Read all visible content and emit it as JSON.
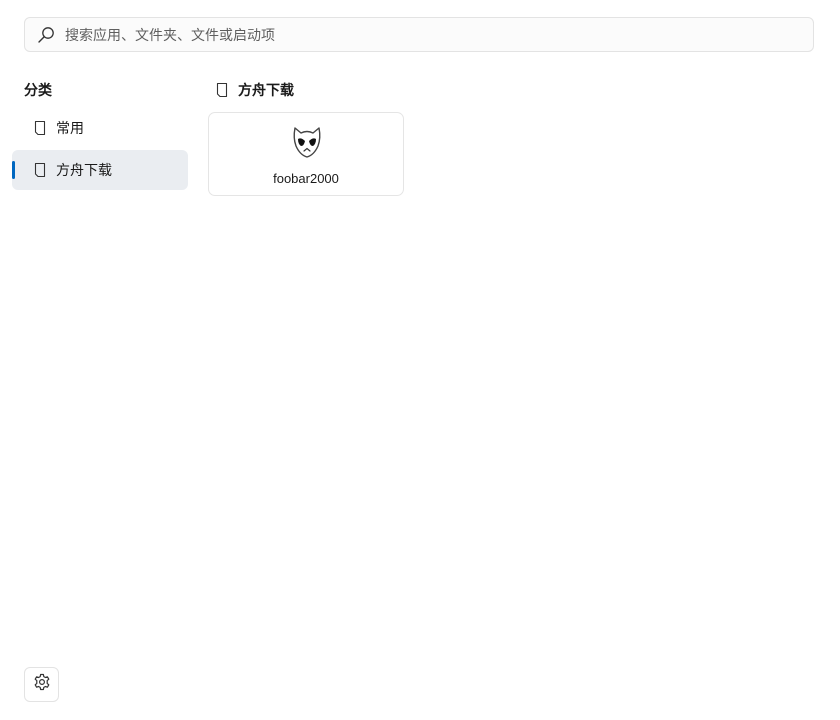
{
  "search": {
    "placeholder": "搜索应用、文件夹、文件或启动项",
    "value": "",
    "icon": "search-icon"
  },
  "sidebar": {
    "title": "分类",
    "items": [
      {
        "label": "常用",
        "icon": "document-icon",
        "active": false
      },
      {
        "label": "方舟下载",
        "icon": "document-icon",
        "active": true
      }
    ]
  },
  "main": {
    "section_title": "方舟下载",
    "section_icon": "document-icon",
    "apps": [
      {
        "name": "foobar2000",
        "icon": "foobar2000-icon"
      }
    ]
  },
  "footer": {
    "settings_icon": "gear-icon"
  },
  "colors": {
    "accent": "#0067c0",
    "active_bg": "#eaedf1",
    "border": "#e3e3e3"
  }
}
